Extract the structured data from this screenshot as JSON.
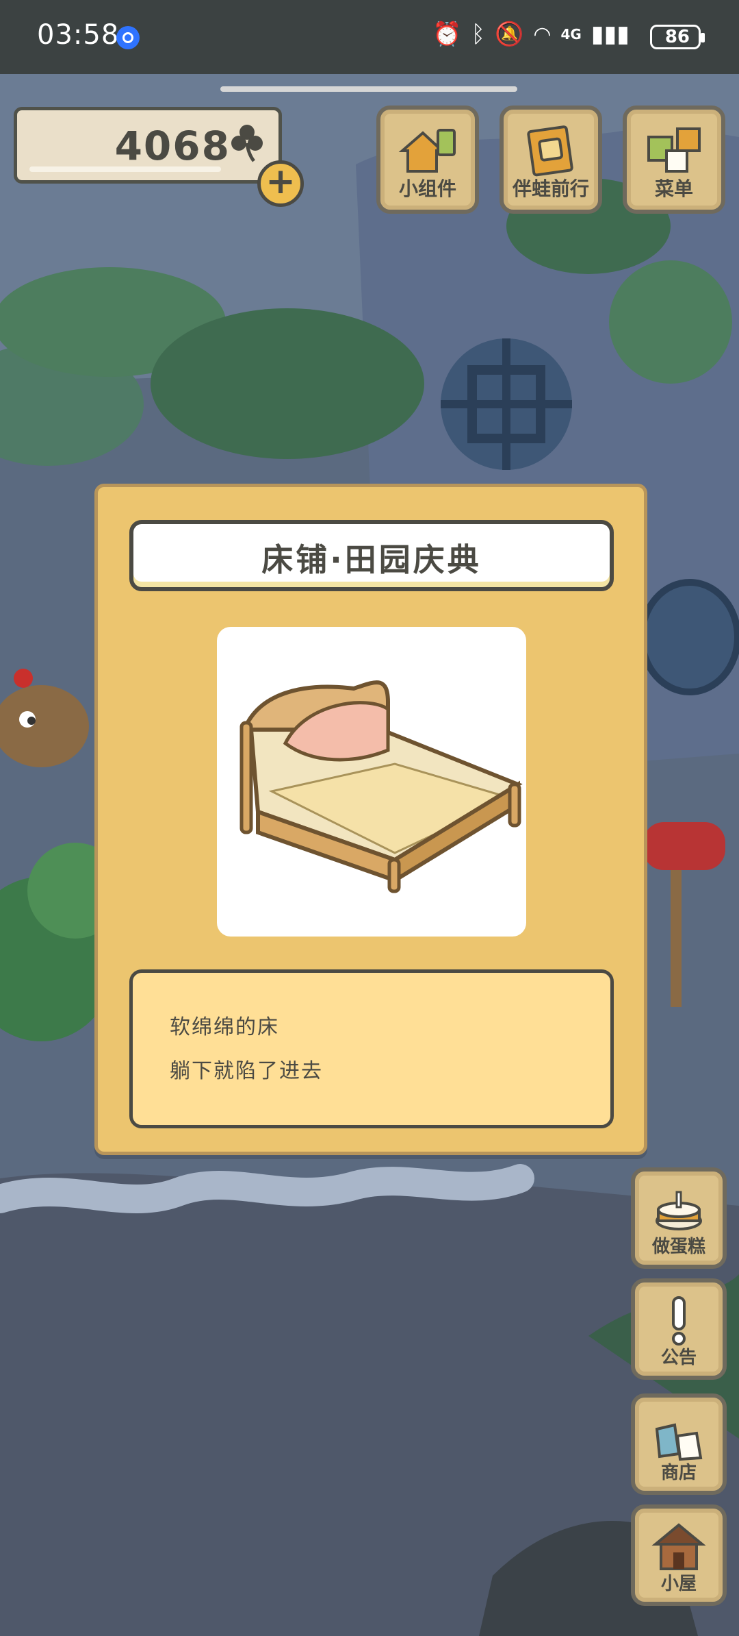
{
  "status_bar": {
    "time": "03:58",
    "network": "4G",
    "battery": "86"
  },
  "currency": {
    "value": "4068",
    "icon": "clover-icon"
  },
  "top_buttons": [
    {
      "label": "小组件",
      "icon": "widget-icon"
    },
    {
      "label": "伴蛙前行",
      "icon": "journey-book-icon"
    },
    {
      "label": "菜单",
      "icon": "menu-cards-icon"
    }
  ],
  "side_buttons": [
    {
      "label": "做蛋糕",
      "icon": "cake-icon"
    },
    {
      "label": "公告",
      "icon": "exclamation-icon"
    },
    {
      "label": "商店",
      "icon": "shop-bags-icon"
    },
    {
      "label": "小屋",
      "icon": "house-icon"
    }
  ],
  "item_card": {
    "title": "床铺·田园庆典",
    "image": "bed-illustration",
    "description": [
      "软绵绵的床",
      "躺下就陷了进去"
    ]
  },
  "colors": {
    "card": "#ecc56f",
    "card_border": "#b8955a",
    "desc_box": "#ffdf96",
    "ink": "#4b4a43",
    "button_wood": "#dcc28a"
  }
}
